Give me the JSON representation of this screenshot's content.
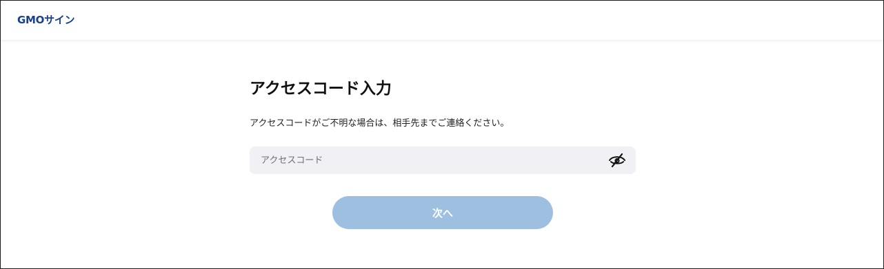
{
  "header": {
    "logo_text": "GMOサイン"
  },
  "main": {
    "title": "アクセスコード入力",
    "description": "アクセスコードがご不明な場合は、相手先までご連絡ください。",
    "access_code": {
      "value": "",
      "placeholder": "アクセスコード",
      "visibility_icon": "eye-off-icon"
    },
    "next_button_label": "次へ"
  },
  "colors": {
    "brand": "#1a3f8f",
    "button_disabled": "#9fbfe1",
    "input_background": "#f1f0f4"
  }
}
